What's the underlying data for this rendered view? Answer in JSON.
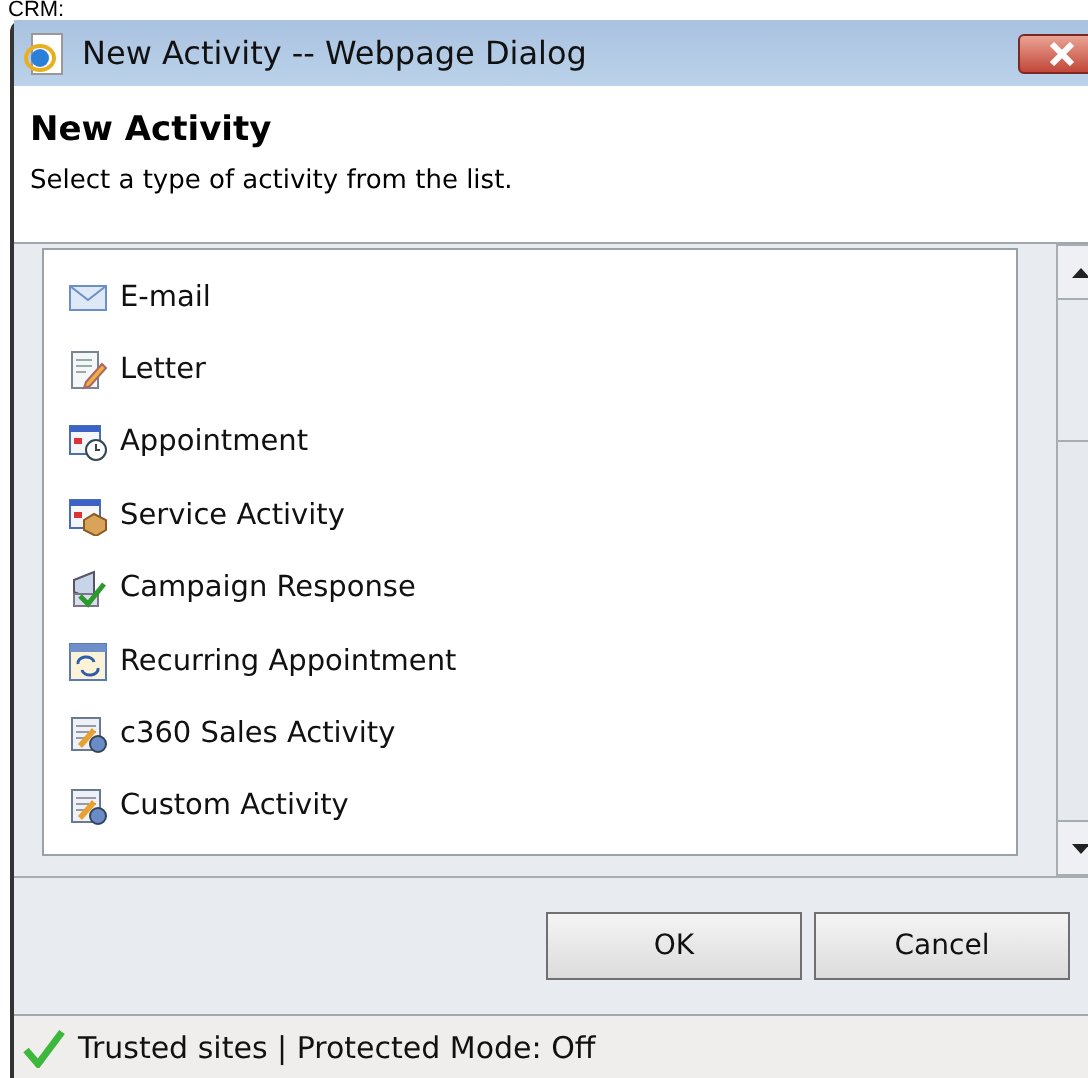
{
  "backdrop_text": "CRM:",
  "window": {
    "title": "New Activity -- Webpage Dialog"
  },
  "header": {
    "title": "New Activity",
    "subtitle": "Select a type of activity from the list."
  },
  "activities": [
    {
      "label": "E-mail",
      "kind": "email"
    },
    {
      "label": "Letter",
      "kind": "letter"
    },
    {
      "label": "Appointment",
      "kind": "appointment"
    },
    {
      "label": "Service Activity",
      "kind": "service"
    },
    {
      "label": "Campaign Response",
      "kind": "campaign"
    },
    {
      "label": "Recurring Appointment",
      "kind": "recurring"
    },
    {
      "label": "c360 Sales Activity",
      "kind": "custom"
    },
    {
      "label": "Custom Activity",
      "kind": "custom"
    }
  ],
  "buttons": [
    "OK",
    "Cancel"
  ],
  "status_bar": {
    "text": "Trusted sites | Protected Mode: Off"
  }
}
